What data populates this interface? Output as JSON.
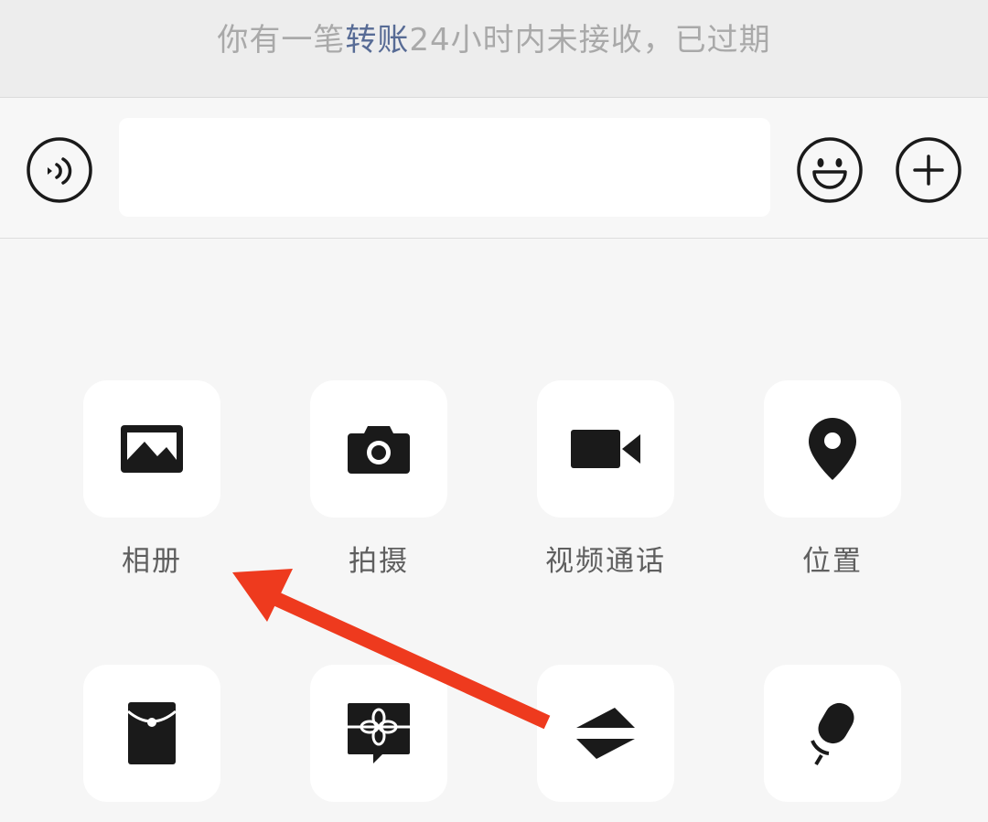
{
  "notice": {
    "text_before": "你有一笔",
    "link_text": "转账",
    "text_after": "24小时内未接收，已过期"
  },
  "input_bar": {
    "voice_icon": "voice-icon",
    "text_value": "",
    "emoji_icon": "emoji-icon",
    "plus_icon": "plus-icon"
  },
  "tools": {
    "row1": [
      {
        "label": "相册",
        "icon": "album-icon"
      },
      {
        "label": "拍摄",
        "icon": "camera-icon"
      },
      {
        "label": "视频通话",
        "icon": "video-call-icon"
      },
      {
        "label": "位置",
        "icon": "location-icon"
      }
    ],
    "row2": [
      {
        "label": "",
        "icon": "red-packet-icon"
      },
      {
        "label": "",
        "icon": "gift-icon"
      },
      {
        "label": "",
        "icon": "transfer-icon"
      },
      {
        "label": "",
        "icon": "voice-input-icon"
      }
    ]
  },
  "annotation": {
    "arrow_color": "#ee3a1e"
  },
  "colors": {
    "link": "#576b95",
    "icon": "#1a1a1a"
  }
}
